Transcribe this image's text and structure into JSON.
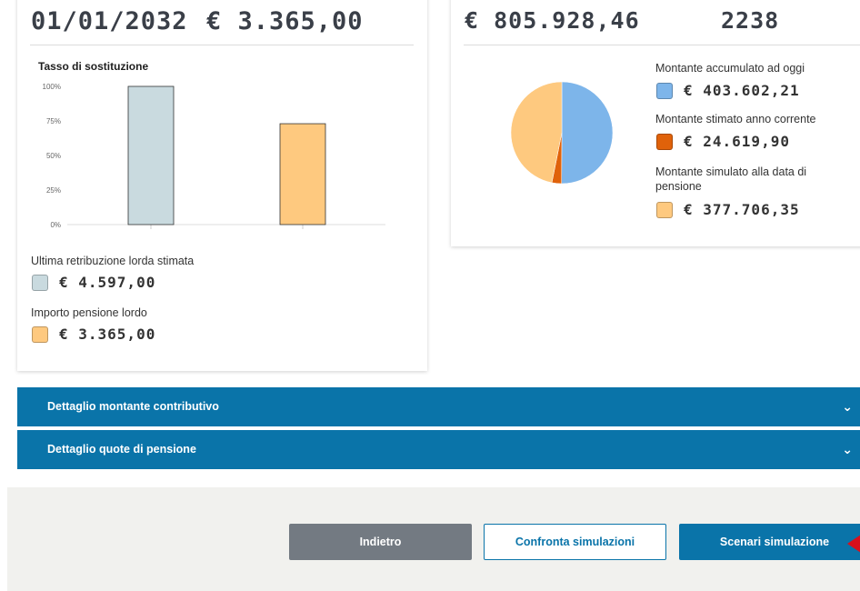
{
  "left_card": {
    "date": "01/01/2032",
    "pension_amount": "€ 3.365,00",
    "chart_title": "Tasso di sostituzione",
    "legend": [
      {
        "label": "Ultima retribuzione lorda stimata",
        "value": "€ 4.597,00",
        "color": "#c9dadf"
      },
      {
        "label": "Importo pensione lordo",
        "value": "€ 3.365,00",
        "color": "#fec97f"
      }
    ]
  },
  "right_card": {
    "total": "€ 805.928,46",
    "count": "2238",
    "legend": [
      {
        "label": "Montante accumulato ad oggi",
        "value": "€ 403.602,21",
        "color": "#7db5ea"
      },
      {
        "label": "Montante stimato anno corrente",
        "value": "€ 24.619,90",
        "color": "#e0620a"
      },
      {
        "label": "Montante simulato alla data di pensione",
        "value": "€ 377.706,35",
        "color": "#fec97f"
      }
    ]
  },
  "accordions": [
    {
      "label": "Dettaglio montante contributivo"
    },
    {
      "label": "Dettaglio quote di pensione"
    }
  ],
  "buttons": {
    "back": "Indietro",
    "compare": "Confronta simulazioni",
    "scenari": "Scenari simulazione"
  },
  "chart_data": [
    {
      "type": "bar",
      "title": "Tasso di sostituzione",
      "categories": [
        "Ultima retribuzione lorda stimata",
        "Importo pensione lordo"
      ],
      "values": [
        100,
        73
      ],
      "colors": [
        "#c9dadf",
        "#fec97f"
      ],
      "y_ticks": [
        "0%",
        "25%",
        "50%",
        "75%",
        "100%"
      ],
      "ylim": [
        0,
        100
      ]
    },
    {
      "type": "pie",
      "labels": [
        "Montante accumulato ad oggi",
        "Montante stimato anno corrente",
        "Montante simulato alla data di pensione"
      ],
      "values": [
        403602.21,
        24619.9,
        377706.35
      ],
      "colors": [
        "#7db5ea",
        "#e0620a",
        "#fec97f"
      ]
    }
  ]
}
